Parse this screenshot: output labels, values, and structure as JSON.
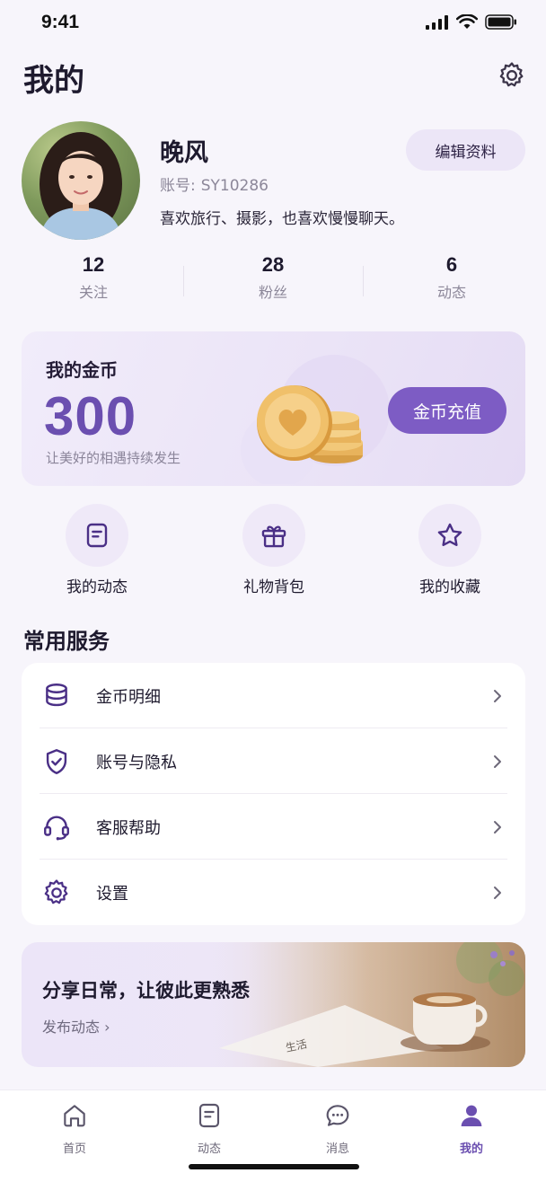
{
  "status_bar": {
    "time": "9:41"
  },
  "header": {
    "title": "我的",
    "settings_icon": "gear-icon"
  },
  "profile": {
    "name": "晚风",
    "account_prefix": "账号:",
    "account_id": "SY10286",
    "bio": "喜欢旅行、摄影，也喜欢慢慢聊天。",
    "edit_label": "编辑资料"
  },
  "stats": [
    {
      "value": "12",
      "label": "关注"
    },
    {
      "value": "28",
      "label": "粉丝"
    },
    {
      "value": "6",
      "label": "动态"
    }
  ],
  "coins": {
    "title": "我的金币",
    "amount": "300",
    "subtitle": "让美好的相遇持续发生",
    "recharge_label": "金币充值",
    "accent_color": "#7d5cc4"
  },
  "quick_actions": [
    {
      "label": "我的动态",
      "icon": "document-icon"
    },
    {
      "label": "礼物背包",
      "icon": "gift-icon"
    },
    {
      "label": "我的收藏",
      "icon": "star-icon"
    }
  ],
  "services": {
    "title": "常用服务",
    "items": [
      {
        "label": "金币明细",
        "icon": "coin-stack-icon"
      },
      {
        "label": "账号与隐私",
        "icon": "shield-check-icon"
      },
      {
        "label": "客服帮助",
        "icon": "headset-icon"
      },
      {
        "label": "设置",
        "icon": "gear-icon"
      }
    ]
  },
  "banner": {
    "title": "分享日常，让彼此更熟悉",
    "link_label": "发布动态 ›"
  },
  "tabbar": {
    "items": [
      {
        "label": "首页",
        "icon": "home-icon",
        "active": false
      },
      {
        "label": "动态",
        "icon": "document-icon",
        "active": false
      },
      {
        "label": "消息",
        "icon": "chat-bubble-icon",
        "active": false
      },
      {
        "label": "我的",
        "icon": "person-icon",
        "active": true
      }
    ],
    "active_color": "#6b4fb0"
  }
}
